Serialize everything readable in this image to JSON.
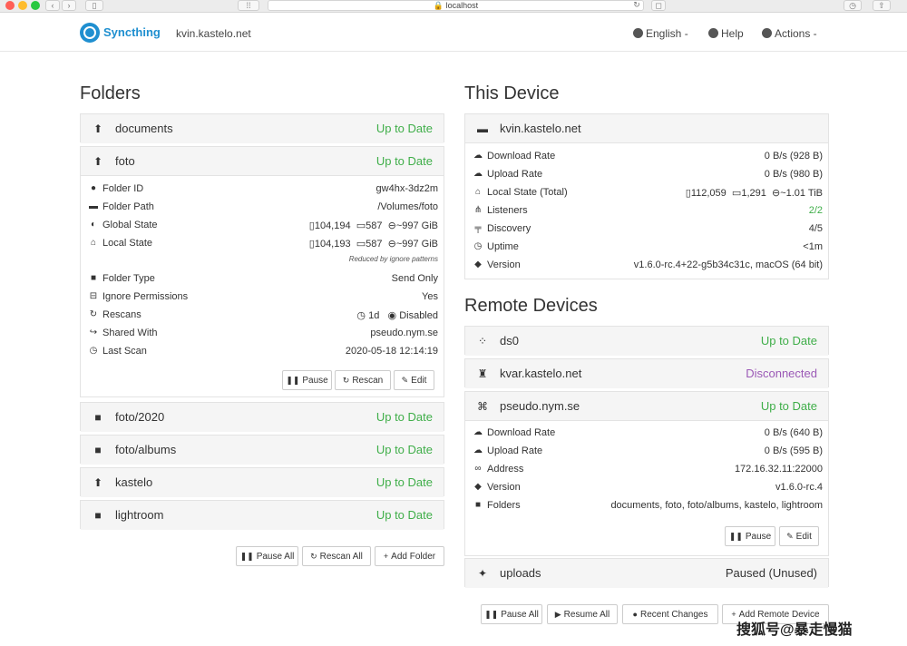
{
  "browser": {
    "url": "localhost"
  },
  "navbar": {
    "brand": "Syncthing",
    "hostname": "kvin.kastelo.net",
    "language": "English -",
    "help": "Help",
    "actions": "Actions -"
  },
  "folders": {
    "heading": "Folders",
    "items": [
      {
        "name": "documents",
        "status": "Up to Date"
      },
      {
        "name": "foto",
        "status": "Up to Date"
      },
      {
        "name": "foto/2020",
        "status": "Up to Date"
      },
      {
        "name": "foto/albums",
        "status": "Up to Date"
      },
      {
        "name": "kastelo",
        "status": "Up to Date"
      },
      {
        "name": "lightroom",
        "status": "Up to Date"
      }
    ],
    "detail": {
      "folder_id_label": "Folder ID",
      "folder_id": "gw4hx-3dz2m",
      "folder_path_label": "Folder Path",
      "folder_path": "/Volumes/foto",
      "global_state_label": "Global State",
      "global_files": "104,194",
      "global_dirs": "587",
      "global_size": "~997 GiB",
      "local_state_label": "Local State",
      "local_files": "104,193",
      "local_dirs": "587",
      "local_size": "~997 GiB",
      "ignore_note": "Reduced by ignore patterns",
      "folder_type_label": "Folder Type",
      "folder_type": "Send Only",
      "ignore_perms_label": "Ignore Permissions",
      "ignore_perms": "Yes",
      "rescans_label": "Rescans",
      "rescan_interval": "1d",
      "watch": "Disabled",
      "shared_with_label": "Shared With",
      "shared_with": "pseudo.nym.se",
      "last_scan_label": "Last Scan",
      "last_scan": "2020-05-18 12:14:19",
      "pause_btn": "Pause",
      "rescan_btn": "Rescan",
      "edit_btn": "Edit"
    },
    "buttons": {
      "pause_all": "Pause All",
      "rescan_all": "Rescan All",
      "add_folder": "Add Folder"
    }
  },
  "this_device": {
    "heading": "This Device",
    "name": "kvin.kastelo.net",
    "download_rate_label": "Download Rate",
    "download_rate": "0 B/s (928 B)",
    "upload_rate_label": "Upload Rate",
    "upload_rate": "0 B/s (980 B)",
    "local_state_label": "Local State (Total)",
    "ls_files": "112,059",
    "ls_dirs": "1,291",
    "ls_size": "~1.01 TiB",
    "listeners_label": "Listeners",
    "listeners": "2/2",
    "discovery_label": "Discovery",
    "discovery": "4/5",
    "uptime_label": "Uptime",
    "uptime": "<1m",
    "version_label": "Version",
    "version": "v1.6.0-rc.4+22-g5b34c31c, macOS (64 bit)"
  },
  "remote_devices": {
    "heading": "Remote Devices",
    "items": [
      {
        "name": "ds0",
        "status": "Up to Date"
      },
      {
        "name": "kvar.kastelo.net",
        "status": "Disconnected"
      },
      {
        "name": "pseudo.nym.se",
        "status": "Up to Date"
      },
      {
        "name": "uploads",
        "status": "Paused (Unused)"
      }
    ],
    "detail": {
      "download_rate_label": "Download Rate",
      "download_rate": "0 B/s (640 B)",
      "upload_rate_label": "Upload Rate",
      "upload_rate": "0 B/s (595 B)",
      "address_label": "Address",
      "address": "172.16.32.11:22000",
      "version_label": "Version",
      "version": "v1.6.0-rc.4",
      "folders_label": "Folders",
      "folders": "documents, foto, foto/albums, kastelo, lightroom",
      "pause_btn": "Pause",
      "edit_btn": "Edit"
    },
    "buttons": {
      "pause_all": "Pause All",
      "resume_all": "Resume All",
      "recent_changes": "Recent Changes",
      "add_device": "Add Remote Device"
    }
  },
  "watermark": "搜狐号@暴走慢猫",
  "colors": {
    "green": "#3fae49",
    "purple": "#9b59b6",
    "brand": "#1f8fd0"
  }
}
